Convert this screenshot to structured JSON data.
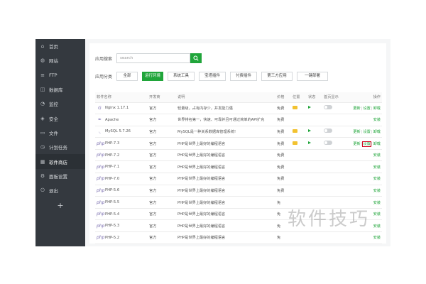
{
  "sidebar": {
    "items": [
      {
        "label": "首页",
        "icon": "home-icon",
        "glyph": "⌂"
      },
      {
        "label": "网站",
        "icon": "globe-icon",
        "glyph": "◍"
      },
      {
        "label": "FTP",
        "icon": "ftp-icon",
        "glyph": "≡"
      },
      {
        "label": "数据库",
        "icon": "database-icon",
        "glyph": "◫"
      },
      {
        "label": "监控",
        "icon": "monitor-icon",
        "glyph": "◔"
      },
      {
        "label": "安全",
        "icon": "shield-icon",
        "glyph": "◈"
      },
      {
        "label": "文件",
        "icon": "folder-icon",
        "glyph": "▭"
      },
      {
        "label": "计划任务",
        "icon": "clock-icon",
        "glyph": "◷"
      },
      {
        "label": "软件商店",
        "icon": "store-icon",
        "glyph": "▦",
        "active": true
      },
      {
        "label": "面板设置",
        "icon": "gear-icon",
        "glyph": "⚙"
      },
      {
        "label": "退出",
        "icon": "logout-icon",
        "glyph": "⏻"
      }
    ],
    "add_glyph": "+"
  },
  "search": {
    "label": "应用搜索",
    "placeholder": "search",
    "button_icon": "search-icon"
  },
  "categories": {
    "label": "应用分类",
    "items": [
      "全部",
      "运行环境",
      "系统工具",
      "宝塔插件",
      "付费插件",
      "第三方应用",
      "一键部署"
    ],
    "active_index": 1
  },
  "table": {
    "headers": [
      "软件名称",
      "开发商",
      "说明",
      "价格",
      "位置",
      "状态",
      "首页显示",
      "操作"
    ],
    "rows": [
      {
        "name": "Nginx 1.17.1",
        "icon_glyph": "G",
        "dev": "官方",
        "desc": "轻量级，占有内存少，并发能力强",
        "price": "免费",
        "folder": true,
        "running": true,
        "toggle": true,
        "actions": [
          "更新",
          "设置",
          "卸载"
        ]
      },
      {
        "name": "Apache",
        "icon_glyph": "✒",
        "dev": "官方",
        "desc": "世界排名第一，快速、可靠并且可通过简单的API扩充",
        "price": "免费",
        "folder": false,
        "running": false,
        "toggle": false,
        "actions": [
          "安装"
        ]
      },
      {
        "name": "MySQL 5.7.26",
        "icon_glyph": "◟",
        "dev": "官方",
        "desc": "MySQL是一种关系数据库管理系统!",
        "price": "免费",
        "folder": true,
        "running": true,
        "toggle": true,
        "actions": [
          "更新",
          "设置",
          "卸载"
        ]
      },
      {
        "name": "PHP-7.3",
        "icon_glyph": "php",
        "dev": "官方",
        "desc": "PHP是世界上最好的编程语言",
        "price": "免费",
        "folder": true,
        "running": true,
        "toggle": true,
        "actions": [
          "更新",
          "设置",
          "卸载"
        ],
        "highlight_index": 1
      },
      {
        "name": "PHP-7.2",
        "icon_glyph": "php",
        "dev": "官方",
        "desc": "PHP是世界上最好的编程语言",
        "price": "免费",
        "folder": false,
        "running": false,
        "toggle": false,
        "actions": [
          "安装"
        ]
      },
      {
        "name": "PHP-7.1",
        "icon_glyph": "php",
        "dev": "官方",
        "desc": "PHP是世界上最好的编程语言",
        "price": "免费",
        "folder": false,
        "running": false,
        "toggle": false,
        "actions": [
          "安装"
        ]
      },
      {
        "name": "PHP-7.0",
        "icon_glyph": "php",
        "dev": "官方",
        "desc": "PHP是世界上最好的编程语言",
        "price": "免费",
        "folder": false,
        "running": false,
        "toggle": false,
        "actions": [
          "安装"
        ]
      },
      {
        "name": "PHP-5.6",
        "icon_glyph": "php",
        "dev": "官方",
        "desc": "PHP是世界上最好的编程语言",
        "price": "免费",
        "folder": false,
        "running": false,
        "toggle": false,
        "actions": [
          "安装"
        ]
      },
      {
        "name": "PHP-5.5",
        "icon_glyph": "php",
        "dev": "官方",
        "desc": "PHP是世界上最好的编程语言",
        "price": "免",
        "folder": false,
        "running": false,
        "toggle": false,
        "actions": [
          "安装"
        ]
      },
      {
        "name": "PHP-5.4",
        "icon_glyph": "php",
        "dev": "官方",
        "desc": "PHP是世界上最好的编程语言",
        "price": "免",
        "folder": false,
        "running": false,
        "toggle": false,
        "actions": [
          "安装"
        ]
      },
      {
        "name": "PHP-5.3",
        "icon_glyph": "php",
        "dev": "官方",
        "desc": "PHP是世界上最好的编程语言",
        "price": "免",
        "folder": false,
        "running": false,
        "toggle": false,
        "actions": [
          "安装"
        ]
      },
      {
        "name": "PHP-5.2",
        "icon_glyph": "php",
        "dev": "官方",
        "desc": "PHP是世界上最好的编程语言",
        "price": "免",
        "folder": false,
        "running": false,
        "toggle": false,
        "actions": [
          "安装"
        ]
      }
    ]
  },
  "watermark": "软件技巧",
  "colors": {
    "accent": "#20a53a",
    "sidebar": "#34393f",
    "highlight": "#d0021b"
  }
}
